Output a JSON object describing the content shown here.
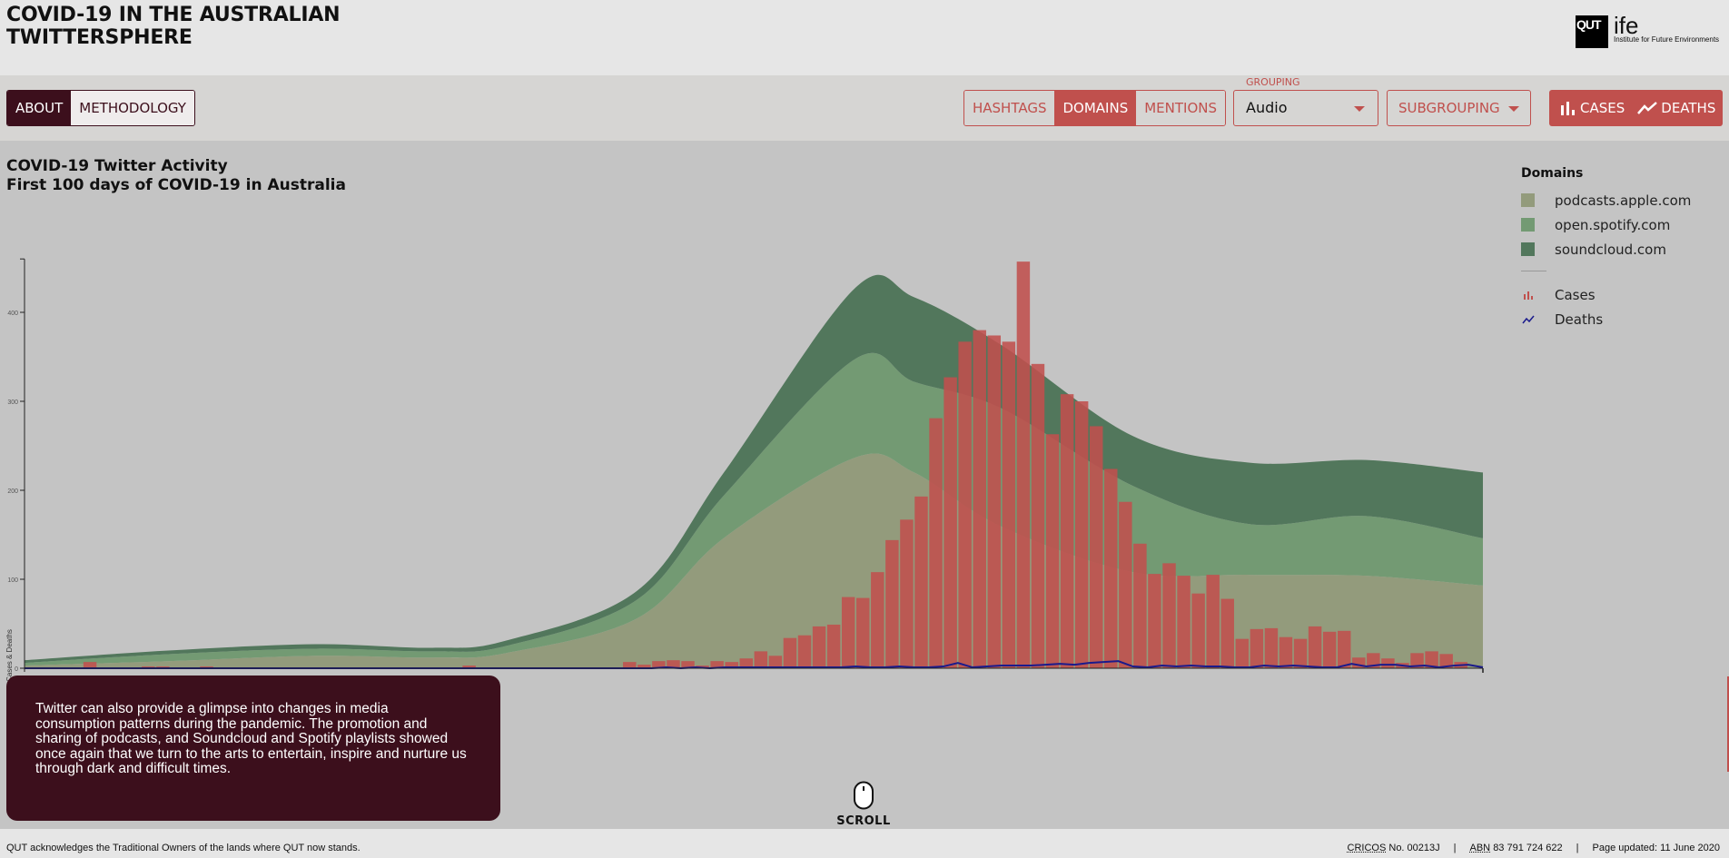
{
  "header": {
    "title_line1": "COVID-19 IN THE AUSTRALIAN",
    "title_line2": "TWITTERSPHERE",
    "logo_mark": "QUT",
    "logo_name": "ife",
    "logo_subtitle": "Institute for Future Environments"
  },
  "toolbar": {
    "about_label": "ABOUT",
    "methodology_label": "METHODOLOGY",
    "view_tabs": [
      {
        "label": "HASHTAGS",
        "active": false
      },
      {
        "label": "DOMAINS",
        "active": true
      },
      {
        "label": "MENTIONS",
        "active": false
      }
    ],
    "grouping_label": "GROUPING",
    "grouping_value": "Audio",
    "subgrouping_label": "SUBGROUPING",
    "cases_label": "CASES",
    "deaths_label": "DEATHS"
  },
  "legend": {
    "title": "Domains",
    "items": [
      {
        "label": "podcasts.apple.com",
        "color": "#939b7c"
      },
      {
        "label": "open.spotify.com",
        "color": "#739a73"
      },
      {
        "label": "soundcloud.com",
        "color": "#52775c"
      }
    ],
    "cases_label": "Cases",
    "deaths_label": "Deaths"
  },
  "story": {
    "text": "Twitter can also provide a glimpse into changes in media consumption patterns during the pandemic. The promotion and sharing of podcasts, and Soundcloud and Spotify playlists showed once again that we turn to the arts to entertain, inspire and nurture us through dark and difficult times."
  },
  "scroll_label": "SCROLL",
  "footer": {
    "acknowledgement": "QUT acknowledges the Traditional Owners of the lands where QUT now stands.",
    "cricos_abbr": "CRICOS",
    "cricos_value": "No. 00213J",
    "abn_abbr": "ABN",
    "abn_value": "83 791 724 622",
    "separator": "|",
    "updated": "Page updated: 11 June 2020"
  },
  "chart_data": {
    "type": "area",
    "title": "COVID-19 Twitter Activity",
    "subtitle": "First 100 days of COVID-19 in Australia",
    "ylabel": "Cases & Deaths",
    "xlabel": "",
    "ylim": [
      0,
      460
    ],
    "yticks": [
      0,
      100,
      200,
      300,
      400
    ],
    "xlim": [
      0,
      100
    ],
    "legend_position": "top-right",
    "colors": {
      "cases": "#c0504d",
      "deaths": "#1a1a8c"
    },
    "stream_series": [
      {
        "name": "podcasts.apple.com",
        "x": [
          0,
          10,
          20,
          28,
          33,
          42,
          48,
          57,
          61,
          67,
          76,
          84,
          92,
          100
        ],
        "values": [
          3,
          8,
          14,
          12,
          17,
          56,
          147,
          237,
          220,
          159,
          108,
          105,
          104,
          93
        ]
      },
      {
        "name": "open.spotify.com",
        "x": [
          0,
          10,
          20,
          28,
          33,
          42,
          48,
          57,
          61,
          67,
          76,
          84,
          92,
          100
        ],
        "values": [
          3,
          8,
          8,
          7,
          8,
          21,
          48,
          111,
          102,
          133,
          97,
          57,
          67,
          53
        ]
      },
      {
        "name": "soundcloud.com",
        "x": [
          0,
          10,
          20,
          28,
          33,
          42,
          48,
          57,
          61,
          67,
          76,
          84,
          92,
          100
        ],
        "values": [
          3,
          4,
          5,
          4,
          6,
          10,
          26,
          80,
          95,
          71,
          56,
          69,
          63,
          74
        ]
      }
    ],
    "cases": {
      "start_day": 4,
      "values": [
        7,
        0,
        0,
        0,
        2,
        2,
        0,
        0,
        2,
        0,
        0,
        0,
        0,
        0,
        0,
        0,
        0,
        0,
        0,
        0,
        0,
        0,
        0,
        0,
        0,
        0,
        3,
        0,
        0,
        0,
        0,
        0,
        0,
        0,
        0,
        0,
        0,
        7,
        4,
        8,
        9,
        8,
        3,
        8,
        7,
        11,
        19,
        14,
        34,
        37,
        47,
        49,
        80,
        79,
        108,
        144,
        167,
        193,
        281,
        327,
        367,
        380,
        374,
        367,
        457,
        342,
        263,
        308,
        300,
        272,
        224,
        187,
        140,
        106,
        118,
        104,
        84,
        105,
        78,
        33,
        44,
        45,
        35,
        33,
        47,
        41,
        42,
        12,
        17,
        11,
        6,
        17,
        19,
        16,
        7
      ]
    },
    "deaths": {
      "start_day": 0,
      "values": [
        0,
        0,
        0,
        0,
        0,
        0,
        0,
        0,
        0,
        0,
        0,
        0,
        0,
        0,
        0,
        0,
        0,
        0,
        0,
        0,
        0,
        0,
        0,
        0,
        0,
        0,
        0,
        0,
        0,
        0,
        0,
        0,
        0,
        0,
        0,
        0,
        0,
        0,
        0,
        0,
        0,
        0,
        0,
        0,
        1,
        0,
        1,
        0,
        1,
        1,
        1,
        1,
        1,
        1,
        1,
        1,
        1,
        2,
        1,
        1,
        2,
        1,
        1,
        2,
        6,
        1,
        2,
        3,
        3,
        3,
        4,
        5,
        4,
        6,
        7,
        8,
        2,
        1,
        3,
        2,
        3,
        2,
        2,
        1,
        1,
        3,
        2,
        3,
        2,
        1,
        1,
        5,
        2,
        4,
        4,
        2,
        3,
        1,
        3,
        4,
        1
      ]
    }
  }
}
